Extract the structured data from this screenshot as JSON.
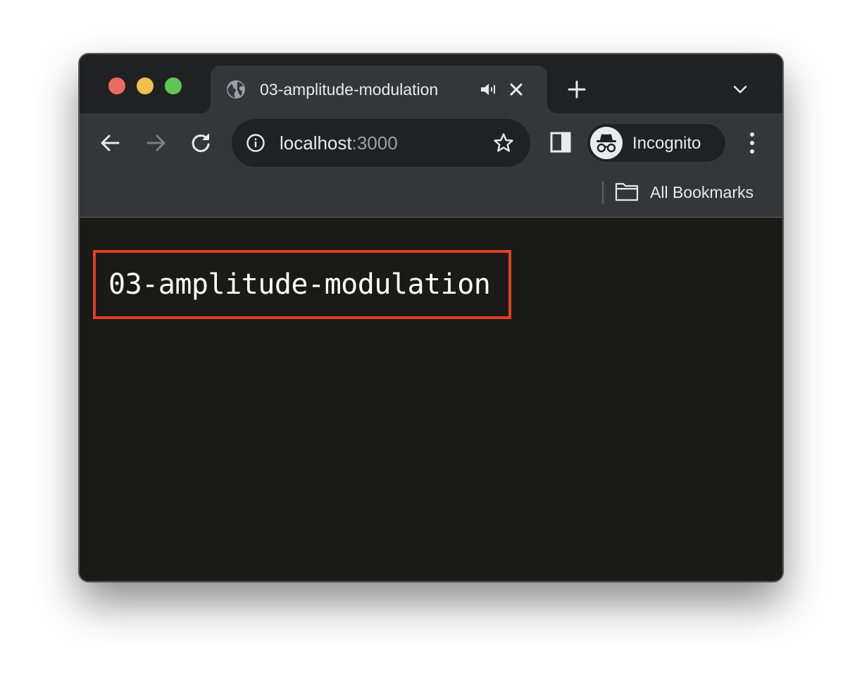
{
  "browser": {
    "tab": {
      "title": "03-amplitude-modulation",
      "favicon": "globe-icon",
      "audio_icon": "speaker-icon",
      "close_icon": "close-icon"
    },
    "new_tab_icon": "plus-icon",
    "tab_search_icon": "chevron-down-icon",
    "nav": {
      "back_icon": "arrow-left-icon",
      "forward_icon": "arrow-right-icon",
      "reload_icon": "reload-icon"
    },
    "omnibox": {
      "host": "localhost",
      "port": ":3000",
      "info_icon": "info-icon",
      "bookmark_icon": "star-icon"
    },
    "side_panel_icon": "side-panel-icon",
    "profile": {
      "label": "Incognito",
      "icon": "incognito-icon"
    },
    "menu_icon": "kebab-menu-icon",
    "bookmarks_bar": {
      "folder_label": "All Bookmarks",
      "folder_icon": "folder-icon"
    }
  },
  "page": {
    "heading": "03-amplitude-modulation"
  },
  "colors": {
    "window_bg": "#1a1a19",
    "titlebar_bg": "#202124",
    "toolbar_bg": "#35363a",
    "highlight_border": "#e2401f",
    "traffic_red": "#ed6a5e",
    "traffic_yellow": "#f5bf4f",
    "traffic_green": "#61c554"
  }
}
